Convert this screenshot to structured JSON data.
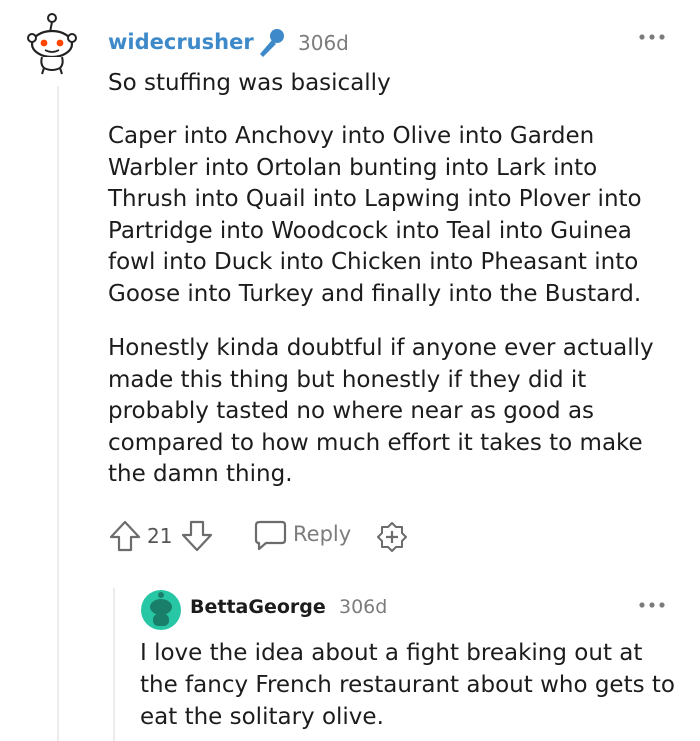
{
  "comment": {
    "username": "widecrusher",
    "time": "306d",
    "paragraphs": [
      "So stuffing was basically",
      "Caper into Anchovy into Olive into Garden Warbler into Ortolan bunting into Lark into Thrush into Quail into Lapwing into Plover into Partridge into Woodcock into Teal into Guinea fowl into Duck into Chicken into Pheasant into Goose into Turkey and finally into the Bustard.",
      "Honestly kinda doubtful if anyone ever actually made this thing but honestly if they did it probably tasted no where near as good as compared to how much effort it takes to make the damn thing."
    ],
    "score": "21",
    "reply_label": "Reply",
    "icons": {
      "avatar": "snoo-avatar-icon",
      "flair": "microphone-icon",
      "more": "more-options-icon",
      "upvote": "upvote-arrow-icon",
      "downvote": "downvote-arrow-icon",
      "reply": "reply-bubble-icon",
      "award": "award-plus-icon"
    },
    "colors": {
      "username": "#3d89c9",
      "flair": "#3d89c9",
      "snoo_eye": "#ff4500"
    }
  },
  "reply": {
    "username": "BettaGeorge",
    "time": "306d",
    "text": "I love the idea about a fight breaking out at the fancy French restaurant about who gets to eat the solitary olive.",
    "icons": {
      "avatar": "green-snoo-avatar-icon",
      "more": "more-options-icon"
    },
    "colors": {
      "avatar": "#27c7a5"
    }
  }
}
